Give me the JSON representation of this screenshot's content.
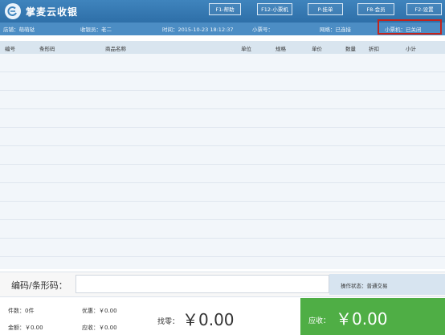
{
  "app": {
    "title": "掌麦云收银"
  },
  "header_buttons": [
    {
      "label": "F1-帮助"
    },
    {
      "label": "F12-小票机"
    },
    {
      "label": "P-挂单"
    },
    {
      "label": "F8-会员"
    },
    {
      "label": "F2-设置"
    }
  ],
  "infobar": {
    "store": "店铺：萌萌哒",
    "cashier": "收银员：老二",
    "time": "时间：2015-10-23 18:12:37",
    "receipt_no": "小票号：",
    "network": "网络：已连接",
    "printer": "小票机：已关闭"
  },
  "table": {
    "columns": [
      "编号",
      "条形码",
      "商品名称",
      "单位",
      "规格",
      "单价",
      "数量",
      "折扣",
      "小计"
    ]
  },
  "input": {
    "label": "编码/条形码：",
    "value": ""
  },
  "op_status": "操作状态：普通交易",
  "footer": {
    "count": "件数：0件",
    "discount": "优惠：￥0.00",
    "amount": "金额：￥0.00",
    "receivable_small": "应收：￥0.00",
    "change_label": "找零：",
    "change_value": "￥0.00",
    "receivable_label": "应收：",
    "receivable_value": "￥0.00"
  },
  "colors": {
    "header": "#3f84bd",
    "infobar": "#4c8dc4",
    "receivable": "#4fae45",
    "highlight": "#c3231b"
  }
}
